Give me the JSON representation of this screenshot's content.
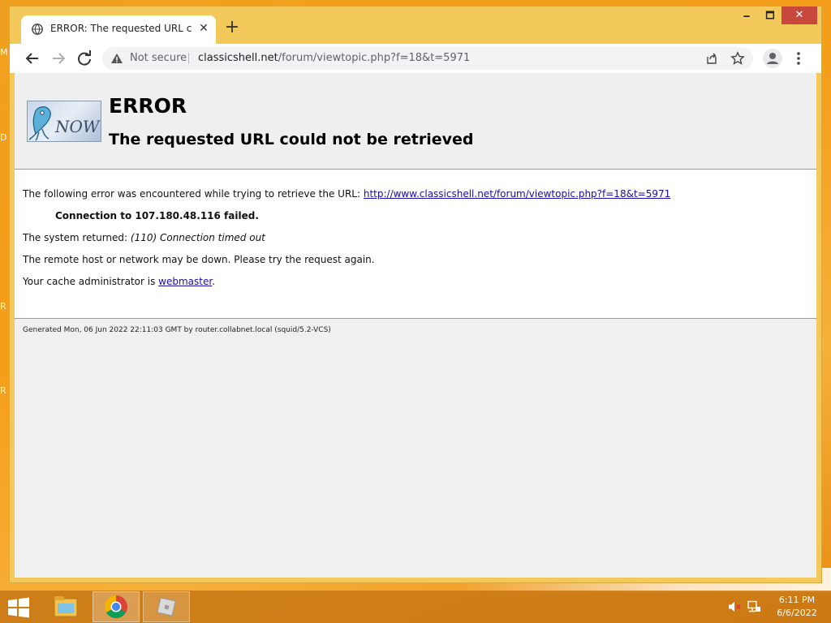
{
  "browser": {
    "tab_title": "ERROR: The requested URL could not be retrieved",
    "new_tab_label": "+",
    "window_controls": {
      "minimize": "🗕",
      "maximize": "🗖",
      "close": "✕"
    },
    "omnibox": {
      "security_label": "Not secure",
      "url_host": "classicshell.net",
      "url_path": "/forum/viewtopic.php?f=18&t=5971"
    }
  },
  "page": {
    "heading": "ERROR",
    "subheading": "The requested URL could not be retrieved",
    "intro_text": "The following error was encountered while trying to retrieve the URL: ",
    "intro_link": "http://www.classicshell.net/forum/viewtopic.php?f=18&t=5971",
    "connection_failed": "Connection to 107.180.48.116 failed.",
    "system_returned_label": "The system returned: ",
    "system_returned_value": "(110) Connection timed out",
    "remote_host_text": "The remote host or network may be down. Please try the request again.",
    "cache_admin_text": "Your cache administrator is ",
    "cache_admin_link": "webmaster",
    "cache_admin_suffix": ".",
    "footer": "Generated Mon, 06 Jun 2022 22:11:03 GMT by router.collabnet.local (squid/5.2-VCS)",
    "logo_text": "NOW"
  },
  "taskbar": {
    "time": "6:11 PM",
    "date": "6/6/2022"
  },
  "desktop": {
    "edge_letters": [
      "M",
      "D",
      "R",
      "R"
    ]
  },
  "colors": {
    "titlebar": "#f4c95c",
    "taskbar": "#c87814",
    "link": "#1a0dab",
    "close_button": "#c9483d"
  }
}
